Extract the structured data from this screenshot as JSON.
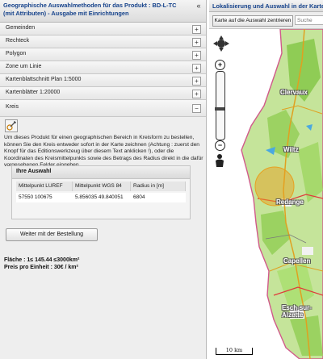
{
  "left_panel": {
    "title": "Geographische Auswahlmethoden für das Produkt : BD-L-TC (mit Attributen) - Ausgabe mit Einrichtungen",
    "collapse_icon": "«"
  },
  "accordion": [
    {
      "label": "Gemeinden",
      "icon": "+"
    },
    {
      "label": "Rechteck",
      "icon": "+"
    },
    {
      "label": "Polygon",
      "icon": "+"
    },
    {
      "label": "Zone um Linie",
      "icon": "+"
    },
    {
      "label": "Kartenblattschnitt Plan 1:5000",
      "icon": "+"
    },
    {
      "label": "Kartenblätter 1:20000",
      "icon": "+"
    },
    {
      "label": "Kreis",
      "icon": "−"
    }
  ],
  "kreis": {
    "description": "Um dieses Produkt für einen geographischen Bereich in Kreisform zu bestellen, können Sie den Kreis entweder sofort in der Karte zeichnen (Achtung : zuerst den Knopf für das Editionswerkzeug über diesem Text anklicken !), oder die Koordinaten des Kreismittelpunkts sowie des Betrags des Radius direkt in die dafür vorgesehenen Felder eingeben.",
    "auswahl_title": "Ihre Auswahl",
    "columns": [
      "Mittelpunkt LUREF",
      "Mittelpunkt WGS 84",
      "Radius in [m]"
    ],
    "row": [
      "57550 100675",
      "5.856035 49.840051",
      "6804"
    ],
    "weiter_button": "Weiter mit der Bestellung",
    "flaeche": "Fläche : 1≤ 145.44 ≤3000km²",
    "preis": "Preis pro Einheit : 30€ / km²"
  },
  "right_panel": {
    "title": "Lokalisierung und Auswahl in der Karte",
    "zentrieren_button": "Karte auf die Auswahl zentrieren",
    "search_placeholder": "Suche"
  },
  "map": {
    "towns": [
      "Clervaux",
      "Wiltz",
      "Redange",
      "Capellen",
      "Esch-sur-Alzette"
    ],
    "scale_label": "10 km",
    "zoom_in": "+",
    "zoom_out": "−",
    "selection_circle_color": "#e8a020"
  }
}
